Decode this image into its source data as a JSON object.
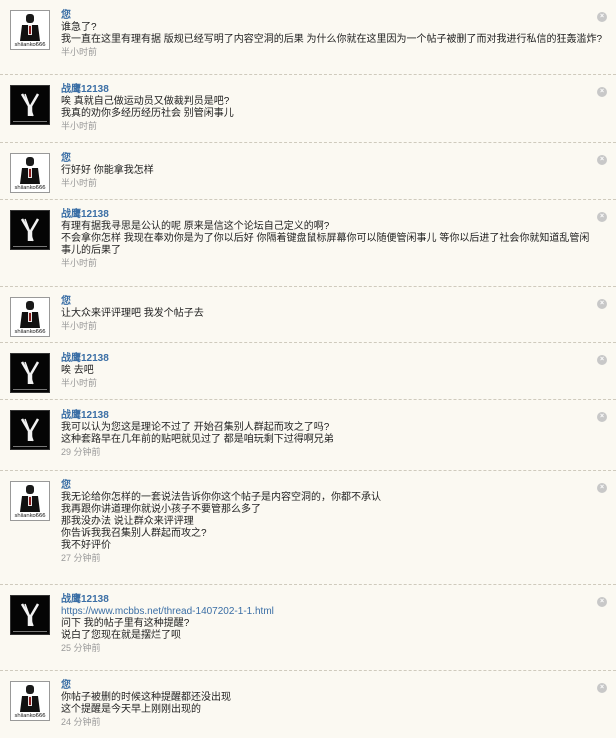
{
  "avatars": {
    "user1_signature": "shiianko666"
  },
  "comments": [
    {
      "author": "您",
      "lines": [
        "谁急了?",
        "我一直在这里有理有据 版规已经写明了内容空洞的后果 为什么你就在这里因为一个帖子被删了而对我进行私信的狂轰滥炸?"
      ],
      "time": "半小时前"
    },
    {
      "author": "战鹰12138",
      "lines": [
        "唉 真就自己做运动员又做裁判员是吧?",
        "我真的劝你多经历经历社会 别管闲事儿"
      ],
      "time": "半小时前"
    },
    {
      "author": "您",
      "lines": [
        "行好好 你能拿我怎样"
      ],
      "time": "半小时前"
    },
    {
      "author": "战鹰12138",
      "lines": [
        "有理有据我寻思是公认的呢 原来是信这个论坛自己定义的啊?",
        "不会拿你怎样 我现在奉劝你是为了你以后好 你隔着键盘鼠标屏幕你可以随便管闲事儿 等你以后进了社会你就知道乱管闲事儿的后果了"
      ],
      "time": "半小时前"
    },
    {
      "author": "您",
      "lines": [
        "让大众来评评理吧 我发个帖子去"
      ],
      "time": "半小时前"
    },
    {
      "author": "战鹰12138",
      "lines": [
        "唉 去吧"
      ],
      "time": "半小时前"
    },
    {
      "author": "战鹰12138",
      "lines": [
        "我可以认为您这是理论不过了 开始召集别人群起而攻之了吗?",
        "这种套路早在几年前的贴吧就见过了 都是咱玩剩下过得啊兄弟"
      ],
      "time": "29 分钟前"
    },
    {
      "author": "您",
      "lines": [
        "我无论给你怎样的一套说法告诉你你这个帖子是内容空洞的，你都不承认",
        "我再跟你讲道理你就说小孩子不要管那么多了",
        "那我没办法 说让群众来评评理",
        "你告诉我我召集别人群起而攻之?",
        "我不好评价"
      ],
      "time": "27 分钟前"
    },
    {
      "author": "战鹰12138",
      "link": "https://www.mcbbs.net/thread-1407202-1-1.html",
      "lines": [
        "问下 我的帖子里有这种提醒?",
        "说白了您现在就是摆烂了呗"
      ],
      "time": "25 分钟前"
    },
    {
      "author": "您",
      "lines": [
        "你帖子被删的时候这种提醒都还没出现",
        "这个提醒是今天早上刚刚出现的"
      ],
      "time": "24 分钟前"
    }
  ]
}
